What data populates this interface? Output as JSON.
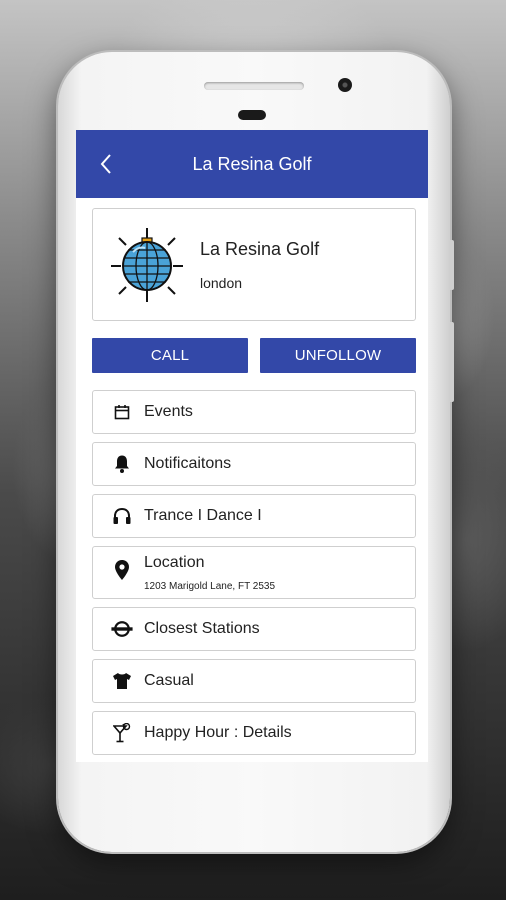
{
  "header": {
    "title": "La Resina Golf",
    "back_icon": "chevron-left-icon"
  },
  "profile": {
    "name": "La Resina Golf",
    "city": "london",
    "icon": "disco-ball-icon"
  },
  "actions": {
    "call_label": "CALL",
    "unfollow_label": "UNFOLLOW"
  },
  "menu": {
    "items": [
      {
        "label": "Events",
        "icon": "calendar-icon"
      },
      {
        "label": "Notificaitons",
        "icon": "bell-icon"
      },
      {
        "label": "Trance I Dance I",
        "icon": "headphones-icon"
      },
      {
        "label": "Location",
        "sublabel": "1203 Marigold Lane, FT 2535",
        "icon": "map-pin-icon"
      },
      {
        "label": "Closest Stations",
        "icon": "underground-icon"
      },
      {
        "label": "Casual",
        "icon": "tshirt-icon"
      },
      {
        "label": "Happy Hour : Details",
        "icon": "cocktail-icon"
      }
    ]
  },
  "colors": {
    "primary": "#3348a8",
    "text": "#222222",
    "border": "#cfcfcf"
  }
}
